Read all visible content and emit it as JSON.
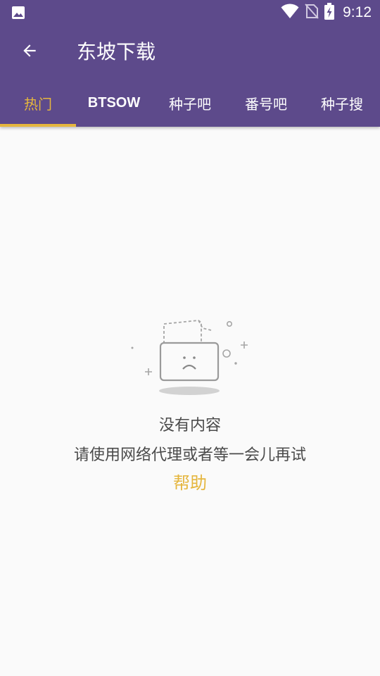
{
  "status_bar": {
    "time": "9:12",
    "left_icon": "image-notification-icon",
    "right_icons": [
      "wifi-icon",
      "no-sim-icon",
      "battery-charging-icon"
    ]
  },
  "toolbar": {
    "back_icon": "arrow-back-icon",
    "title": "东坡下载"
  },
  "tabs": [
    {
      "label": "热门",
      "selected": true
    },
    {
      "label": "BTSOW",
      "selected": false
    },
    {
      "label": "种子吧",
      "selected": false
    },
    {
      "label": "番号吧",
      "selected": false
    },
    {
      "label": "种子搜",
      "selected": false
    }
  ],
  "empty_state": {
    "illustration": "sad-folder-icon",
    "title": "没有内容",
    "subtitle": "请使用网络代理或者等一会儿再试",
    "help_label": "帮助"
  },
  "colors": {
    "app_bar": "#5d4a8b",
    "accent": "#e5b63e",
    "text": "#4a4a4a",
    "background": "#fafafa"
  }
}
